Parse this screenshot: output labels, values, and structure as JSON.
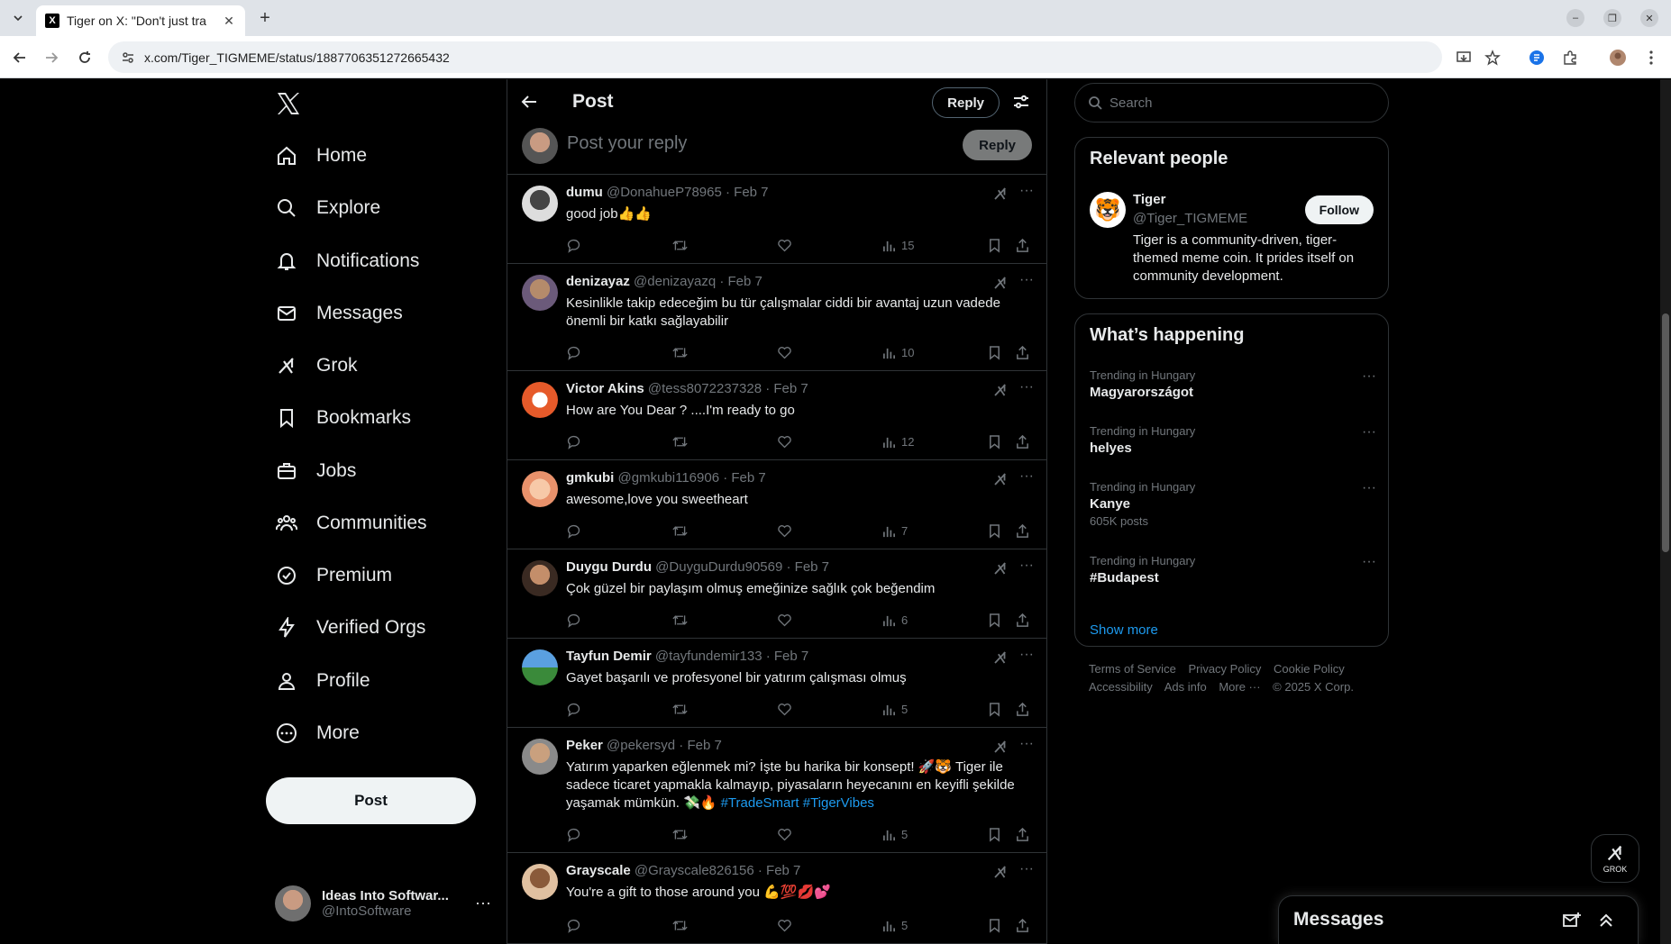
{
  "browser": {
    "tab_title": "Tiger on X: \"Don't just tra",
    "url": "x.com/Tiger_TIGMEME/status/1887706351272665432"
  },
  "nav": {
    "items": [
      {
        "label": "Home",
        "icon": "home-icon"
      },
      {
        "label": "Explore",
        "icon": "search-icon"
      },
      {
        "label": "Notifications",
        "icon": "bell-icon"
      },
      {
        "label": "Messages",
        "icon": "mail-icon"
      },
      {
        "label": "Grok",
        "icon": "grok-icon"
      },
      {
        "label": "Bookmarks",
        "icon": "bookmark-icon"
      },
      {
        "label": "Jobs",
        "icon": "briefcase-icon"
      },
      {
        "label": "Communities",
        "icon": "people-icon"
      },
      {
        "label": "Premium",
        "icon": "verified-icon"
      },
      {
        "label": "Verified Orgs",
        "icon": "lightning-icon"
      },
      {
        "label": "Profile",
        "icon": "person-icon"
      },
      {
        "label": "More",
        "icon": "more-circle-icon"
      }
    ],
    "post_button": "Post",
    "account": {
      "name": "Ideas Into Softwar...",
      "handle": "@IntoSoftware"
    }
  },
  "main": {
    "title": "Post",
    "reply_button": "Reply",
    "composer": {
      "placeholder": "Post your reply",
      "button": "Reply"
    },
    "replies": [
      {
        "name": "dumu",
        "meta": "@DonahueP78965 · Feb 7",
        "text": "good job👍👍",
        "views": "15"
      },
      {
        "name": "denizayaz",
        "meta": "@denizayazq · Feb 7",
        "text": "Kesinlikle takip edeceğim bu tür çalışmalar ciddi bir avantaj uzun vadede önemli bir katkı sağlayabilir",
        "views": "10"
      },
      {
        "name": "Victor Akins",
        "meta": "@tess8072237328 · Feb 7",
        "text": "How are You Dear ? ....I'm ready to go",
        "views": "12"
      },
      {
        "name": "gmkubi",
        "meta": "@gmkubi116906 · Feb 7",
        "text": "awesome,love you sweetheart",
        "views": "7"
      },
      {
        "name": "Duygu Durdu",
        "meta": "@DuyguDurdu90569 · Feb 7",
        "text": "Çok güzel bir paylaşım olmuş emeğinize sağlık çok beğendim",
        "views": "6"
      },
      {
        "name": "Tayfun Demir",
        "meta": "@tayfundemir133 · Feb 7",
        "text": "Gayet başarılı ve profesyonel bir yatırım çalışması olmuş",
        "views": "5"
      },
      {
        "name": "Peker",
        "meta": "@pekersyd · Feb 7",
        "text": "Yatırım yaparken eğlenmek mi? İşte bu harika bir konsept! 🚀🐯 Tiger ile sadece ticaret yapmakla kalmayıp, piyasaların heyecanını en keyifli şekilde yaşamak mümkün. 💸🔥",
        "hashtags": "#TradeSmart #TigerVibes",
        "views": "5"
      },
      {
        "name": "Grayscale",
        "meta": "@Grayscale826156 · Feb 7",
        "text": "You're a gift to those around you 💪💯💋💕",
        "views": "5"
      }
    ]
  },
  "right": {
    "search_placeholder": "Search",
    "relevant": {
      "title": "Relevant people",
      "name": "Tiger",
      "handle": "@Tiger_TIGMEME",
      "bio": "Tiger is a community-driven, tiger-themed meme coin. It prides itself on community development.",
      "follow": "Follow"
    },
    "happening": {
      "title": "What’s happening",
      "trends": [
        {
          "context": "Trending in Hungary",
          "topic": "Magyarországot",
          "posts": ""
        },
        {
          "context": "Trending in Hungary",
          "topic": "helyes",
          "posts": ""
        },
        {
          "context": "Trending in Hungary",
          "topic": "Kanye",
          "posts": "605K posts"
        },
        {
          "context": "Trending in Hungary",
          "topic": "#Budapest",
          "posts": ""
        }
      ],
      "show_more": "Show more"
    },
    "footer": {
      "links": [
        "Terms of Service",
        "Privacy Policy",
        "Cookie Policy",
        "Accessibility",
        "Ads info",
        "More ···",
        "© 2025 X Corp."
      ]
    }
  },
  "floating": {
    "grok_label": "GROK",
    "messages_title": "Messages"
  }
}
